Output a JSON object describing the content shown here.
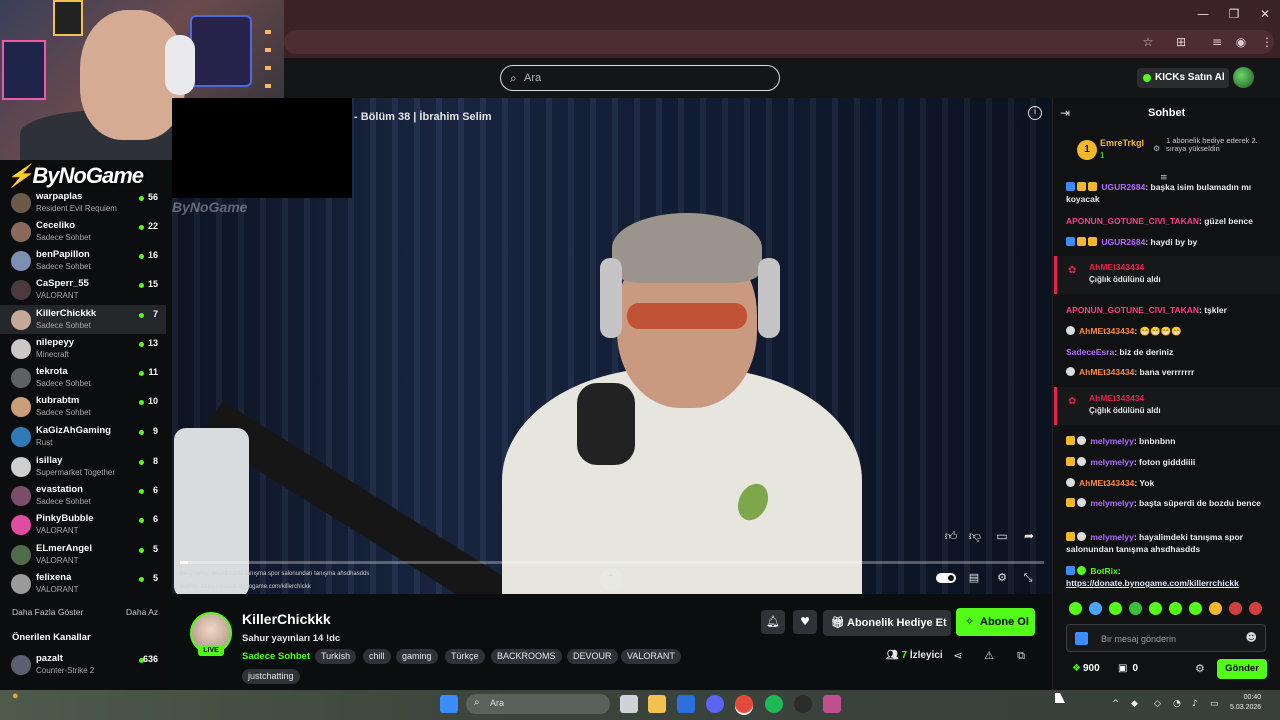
{
  "browser": {
    "window_controls": [
      "—",
      "❐",
      "✕"
    ],
    "toolbar_icons": [
      "star-icon",
      "translate-icon",
      "playlist-icon",
      "profile-icon",
      "kebab-menu-icon"
    ]
  },
  "header": {
    "search_placeholder": "Ara",
    "kicks_label": "KICKs Satın Al"
  },
  "overlay": {
    "brand": "ByNoGame",
    "brand_faint": "ByNoGame"
  },
  "sidebar": {
    "channels": [
      {
        "name": "warpaplas",
        "category": "Resident Evil Requiem",
        "viewers": "56",
        "color": "#6b5a4a"
      },
      {
        "name": "Ceceliko",
        "category": "Sadece Sohbet",
        "viewers": "22",
        "color": "#8a6a5d"
      },
      {
        "name": "benPapillon",
        "category": "Sadece Sohbet",
        "viewers": "16",
        "color": "#7d8fb2"
      },
      {
        "name": "CaSperr_55",
        "category": "VALORANT",
        "viewers": "15",
        "color": "#4b3b3f"
      },
      {
        "name": "KillerChickkk",
        "category": "Sadece Sohbet",
        "viewers": "7",
        "color": "#c4a898"
      },
      {
        "name": "nilepeyy",
        "category": "Minecraft",
        "viewers": "13",
        "color": "#ccc8c8"
      },
      {
        "name": "tekrota",
        "category": "Sadece Sohbet",
        "viewers": "11",
        "color": "#5d6065"
      },
      {
        "name": "kubrabtm",
        "category": "Sadece Sohbet",
        "viewers": "10",
        "color": "#c89f7a"
      },
      {
        "name": "KaGizAhGaming",
        "category": "Rust",
        "viewers": "9",
        "color": "#2e7bb8"
      },
      {
        "name": "isillay",
        "category": "Supermarket Together",
        "viewers": "8",
        "color": "#cfcfcf"
      },
      {
        "name": "evastation",
        "category": "Sadece Sohbet",
        "viewers": "6",
        "color": "#7a4e6b"
      },
      {
        "name": "PinkyBubble",
        "category": "VALORANT",
        "viewers": "6",
        "color": "#e04ca0"
      },
      {
        "name": "ELmerAngel",
        "category": "VALORANT",
        "viewers": "5",
        "color": "#4f6b4b"
      },
      {
        "name": "felixena",
        "category": "VALORANT",
        "viewers": "5",
        "color": "#9a9a9a"
      }
    ],
    "show_more": "Daha Fazla Göster",
    "show_less": "Daha Az",
    "recommended_title": "Önerilen Kanallar",
    "recommended": [
      {
        "name": "pazalt",
        "category": "Counter-Strike 2",
        "viewers": "636",
        "color": "#5a6070"
      }
    ]
  },
  "video": {
    "title": "- Bölüm 38 | İbrahim Selim",
    "progress": 0.009,
    "ticker_1": "melymelyy: hayalimdeki tanışma spor salonundan tanışma ahsdhasdds",
    "ticker_2": "BotRix: https://donate.bynogame.com/killerchickk"
  },
  "stream": {
    "streamer": "KillerChickkk",
    "live_badge": "LIVE",
    "title": "Sahur yayınları 14 !dc",
    "category": "Sadece Sohbet",
    "tags": [
      "Turkish",
      "chill",
      "gaming",
      "Türkçe",
      "BACKROOMS",
      "DEVOUR",
      "VALORANT",
      "justchatting"
    ],
    "gift_label": "Abonelik Hediye Et",
    "subscribe_label": "Abone Ol",
    "viewers_count": "7",
    "viewers_label": "İzleyici"
  },
  "chat": {
    "title": "Sohbet",
    "pinned": {
      "rank": "1",
      "user": "EmreTrkgl",
      "sub_count": "1",
      "message": "1 abonelik hediye ederek 2. sıraya yükseldin"
    },
    "messages": [
      {
        "user": "UGUR2684",
        "color": "#b36bff",
        "text": ": başka isim bulamadın mı koyacak",
        "badges": [
          "#3a8cff",
          "#f3b72b",
          "#f3b72b"
        ]
      },
      {
        "user": "APONUN_GOTUNE_CIVI_TAKAN",
        "color": "#ff3d8b",
        "text": ": güzel bence",
        "badges": []
      },
      {
        "user": "UGUR2684",
        "color": "#b36bff",
        "text": ": haydi by by",
        "badges": [
          "#3a8cff",
          "#f3b72b",
          "#f3b72b"
        ]
      },
      {
        "user": "APONUN_GOTUNE_CIVI_TAKAN",
        "color": "#ff3d8b",
        "text": ": tşkler",
        "badges": []
      },
      {
        "user": "AhMEt343434",
        "color": "#ff8a3d",
        "text": ": 😁😁😁😁",
        "badges": [
          "#dddddd"
        ]
      },
      {
        "user": "SadeceEsra",
        "color": "#b36bff",
        "text": ": biz de deriniz",
        "badges": []
      },
      {
        "user": "AhMEt343434",
        "color": "#ff8a3d",
        "text": ": bana verrrrrrr",
        "badges": [
          "#dddddd"
        ]
      },
      {
        "user": "melymelyy",
        "color": "#b36bff",
        "text": ": bnbnbnn",
        "badges": [
          "#f3b72b",
          "#dddddd"
        ]
      },
      {
        "user": "melymelyy",
        "color": "#b36bff",
        "text": ": foton gidddiiii",
        "badges": [
          "#f3b72b",
          "#dddddd"
        ]
      },
      {
        "user": "AhMEt343434",
        "color": "#ff8a3d",
        "text": ": Yok",
        "badges": [
          "#dddddd"
        ]
      },
      {
        "user": "melymelyy",
        "color": "#b36bff",
        "text": ": başta süperdi de bozdu bence",
        "badges": [
          "#f3b72b",
          "#dddddd"
        ]
      },
      {
        "user": "melymelyy",
        "color": "#b36bff",
        "text": ": hayalimdeki tanışma spor salonundan tanışma ahsdhasdds",
        "badges": [
          "#f3b72b",
          "#dddddd"
        ]
      },
      {
        "user": "BotRix",
        "color": "#53fc18",
        "text": ":",
        "badges": [
          "#3a8cff",
          "#53fc18"
        ]
      }
    ],
    "link": "https://donate.bynogame.com/killerrchickk",
    "redeems": [
      {
        "user": "AhMEt343434",
        "text": "Çığlık ödülünü aldı"
      },
      {
        "user": "AhMEt343434",
        "text": "Çığlık ödülünü aldı"
      }
    ],
    "emote_colors": [
      "#53fc18",
      "#4ba4ff",
      "#53fc18",
      "#3cbf3c",
      "#53fc18",
      "#53fc18",
      "#53fc18",
      "#f3b72b",
      "#d23f3f",
      "#d23f3f",
      "#53fc18"
    ],
    "input_placeholder": "Bir mesaj gönderin",
    "points": "900",
    "store_count": "0",
    "send_label": "Gönder"
  },
  "taskbar": {
    "search_placeholder": "Ara",
    "weather_line1": "",
    "weather_line2": "",
    "clock_time": "00:40",
    "clock_date": "5.03.2026"
  }
}
